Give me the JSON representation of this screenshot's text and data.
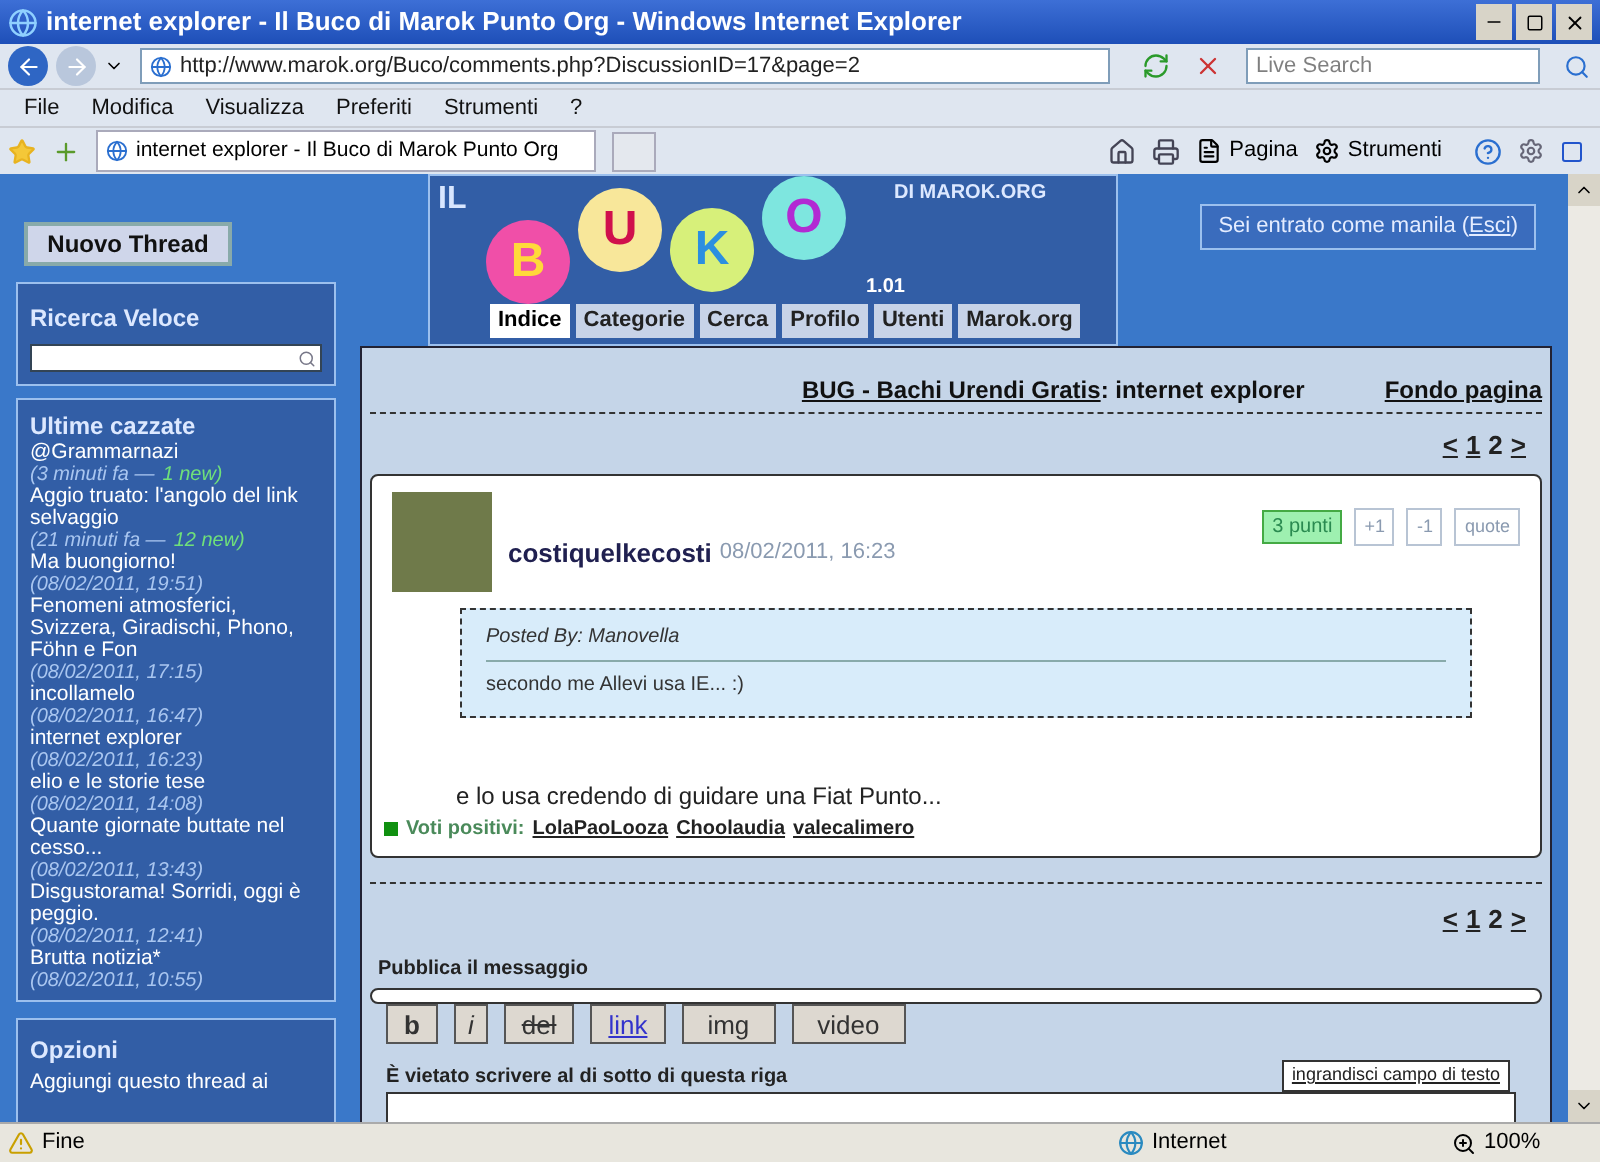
{
  "window": {
    "title": "internet explorer - Il Buco di Marok Punto Org"
  },
  "window_title": "internet explorer - Il Buco di Marok Punto Org - Windows Internet Explorer",
  "address_bar": {
    "url": "http://www.marok.org/Buco/comments.php?DiscussionID=17&page=2"
  },
  "search": {
    "placeholder": "Live Search"
  },
  "menu": [
    "File",
    "Modifica",
    "Visualizza",
    "Preferiti",
    "Strumenti",
    "?"
  ],
  "toolbar": [
    "Pagina",
    "Strumenti"
  ],
  "sidebar": {
    "new_thread": "Nuovo Thread",
    "quick_search": {
      "title": "Ricerca Veloce"
    },
    "recent": {
      "title": "Ultime cazzate",
      "items": [
        {
          "title": "@Grammarnazi",
          "meta": "(3 minuti fa —",
          "new": "1 new)"
        },
        {
          "title": "Aggio truato: l'angolo del link selvaggio",
          "meta": "(21 minuti fa —",
          "new": "12 new)"
        },
        {
          "title": "Ma buongiorno!",
          "meta": "(08/02/2011, 19:51)"
        },
        {
          "title": "Fenomeni atmosferici, Svizzera, Giradischi, Phono, Föhn e Fon",
          "meta": "(08/02/2011, 17:15)"
        },
        {
          "title": "incollamelo",
          "meta": "(08/02/2011, 16:47)"
        },
        {
          "title": "internet explorer",
          "meta": "(08/02/2011, 16:23)"
        },
        {
          "title": "elio e le storie tese",
          "meta": "(08/02/2011, 14:08)"
        },
        {
          "title": "Quante giornate buttate nel cesso...",
          "meta": "(08/02/2011, 13:43)"
        },
        {
          "title": "Disgustorama! Sorridi, oggi è peggio.",
          "meta": "(08/02/2011, 12:41)"
        },
        {
          "title": "Brutta notizia*",
          "meta": "(08/02/2011, 10:55)"
        }
      ]
    },
    "options": {
      "title": "Opzioni",
      "items": [
        "Aggiungi questo thread ai"
      ]
    }
  },
  "logo": {
    "prefix": "IL",
    "letters": [
      "B",
      "U",
      "K",
      "O"
    ],
    "suffix": "DI MAROK.ORG",
    "version": "1.01"
  },
  "nav_tabs": [
    {
      "label": "Indice",
      "selected": true
    },
    {
      "label": "Categorie",
      "selected": false
    },
    {
      "label": "Cerca",
      "selected": false
    },
    {
      "label": "Profilo",
      "selected": false
    },
    {
      "label": "Utenti",
      "selected": false
    },
    {
      "label": "Marok.org",
      "selected": false
    }
  ],
  "login": {
    "text": "Sei entrato come manila (",
    "link": "Esci",
    "after": ")"
  },
  "breadcrumb": {
    "category": "BUG - Bachi Urendi Gratis",
    "thread": ": internet explorer",
    "bottom_link": "Fondo pagina"
  },
  "pagination_top": [
    {
      "label": "<",
      "selected": false
    },
    {
      "label": "1",
      "selected": false
    },
    {
      "label": "2",
      "selected": true
    },
    {
      "label": ">",
      "selected": false
    }
  ],
  "post": {
    "author": "costiquelkecosti",
    "date": "08/02/2011, 16:23",
    "points": "3 punti",
    "actions": [
      "+1",
      "-1",
      "quote"
    ],
    "quote": {
      "header": "Posted By: Manovella",
      "text": "secondo me Allevi usa IE... :)"
    },
    "body": "e lo usa credendo di guidare una Fiat Punto...",
    "votes_label": "Voti positivi:",
    "voters": [
      "LolaPaoLooza",
      "Choolaudia",
      "valecalimero"
    ]
  },
  "pagination_bottom": [
    {
      "label": "<",
      "selected": false
    },
    {
      "label": "1",
      "selected": false
    },
    {
      "label": "2",
      "selected": true
    },
    {
      "label": ">",
      "selected": false
    }
  ],
  "reply": {
    "title": "Pubblica il messaggio",
    "format_buttons": [
      {
        "label": "b",
        "kind": "bold"
      },
      {
        "label": "i",
        "kind": "italic"
      },
      {
        "label": "del",
        "kind": "strike"
      },
      {
        "label": "link",
        "kind": "link"
      },
      {
        "label": "img",
        "kind": "plain"
      },
      {
        "label": "video",
        "kind": "plain"
      }
    ],
    "warning": "È vietato scrivere al di sotto di questa riga",
    "enlarge": "ingrandisci campo di testo"
  },
  "status_bar": {
    "text": "Fine",
    "zone": "Internet",
    "zoom": "100%"
  }
}
